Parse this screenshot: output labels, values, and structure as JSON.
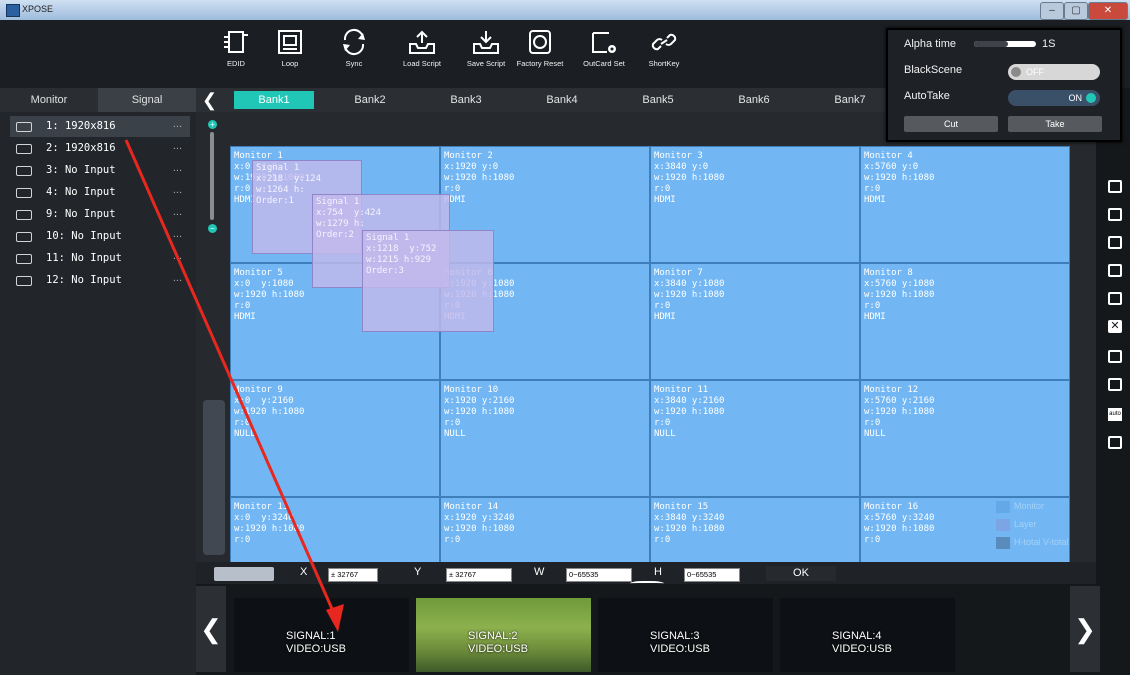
{
  "window": {
    "title": "XPOSE",
    "controls": [
      "–",
      "▢",
      "✕"
    ]
  },
  "toolbar": {
    "tools": [
      {
        "label": "EDID",
        "icon": "edid-icon"
      },
      {
        "label": "Loop",
        "icon": "loop-icon"
      },
      {
        "label": "Sync",
        "icon": "sync-icon"
      },
      {
        "label": "Load Script",
        "icon": "load-script-icon"
      },
      {
        "label": "Save Script",
        "icon": "save-script-icon"
      },
      {
        "label": "Factory Reset",
        "icon": "factory-reset-icon"
      },
      {
        "label": "OutCard Set",
        "icon": "outcard-set-icon"
      },
      {
        "label": "ShortKey",
        "icon": "shortkey-icon"
      }
    ]
  },
  "control_panel": {
    "alpha_time_label": "Alpha time",
    "alpha_time_value": "1S",
    "alpha_time_level": 0.55,
    "blackscene_label": "BlackScene",
    "blackscene_state": "OFF",
    "autotake_label": "AutoTake",
    "autotake_state": "ON",
    "cut_label": "Cut",
    "take_label": "Take",
    "accent": "#21c7b6"
  },
  "left_panel": {
    "tabs": [
      "Monitor",
      "Signal"
    ],
    "active_tab": "Signal",
    "items": [
      {
        "label": "1: 1920x816",
        "selected": true
      },
      {
        "label": "2: 1920x816",
        "selected": false
      },
      {
        "label": "3: No Input",
        "selected": false
      },
      {
        "label": "4: No Input",
        "selected": false
      },
      {
        "label": "9: No Input",
        "selected": false
      },
      {
        "label": "10: No Input",
        "selected": false
      },
      {
        "label": "11: No Input",
        "selected": false
      },
      {
        "label": "12: No Input",
        "selected": false
      }
    ],
    "more": "..."
  },
  "banks": {
    "items": [
      "Bank1",
      "Bank2",
      "Bank3",
      "Bank4",
      "Bank5",
      "Bank6",
      "Bank7"
    ],
    "active": "Bank1",
    "prev": "❮"
  },
  "monitors": [
    {
      "text": "Monitor 1\nx:0  y:0\nw:1920 h:1080\nr:0\nHDMI"
    },
    {
      "text": "Monitor 2\nx:1920 y:0\nw:1920 h:1080\nr:0\nHDMI"
    },
    {
      "text": "Monitor 3\nx:3840 y:0\nw:1920 h:1080\nr:0\nHDMI"
    },
    {
      "text": "Monitor 4\nx:5760 y:0\nw:1920 h:1080\nr:0\nHDMI"
    },
    {
      "text": "Monitor 5\nx:0  y:1080\nw:1920 h:1080\nr:0\nHDMI"
    },
    {
      "text": "Monitor 6\nx:1920 y:1080\nw:1920 h:1080\nr:0\nHDMI"
    },
    {
      "text": "Monitor 7\nx:3840 y:1080\nw:1920 h:1080\nr:0\nHDMI"
    },
    {
      "text": "Monitor 8\nx:5760 y:1080\nw:1920 h:1080\nr:0\nHDMI"
    },
    {
      "text": "Monitor 9\nx:0  y:2160\nw:1920 h:1080\nr:0\nNULL"
    },
    {
      "text": "Monitor 10\nx:1920 y:2160\nw:1920 h:1080\nr:0\nNULL"
    },
    {
      "text": "Monitor 11\nx:3840 y:2160\nw:1920 h:1080\nr:0\nNULL"
    },
    {
      "text": "Monitor 12\nx:5760 y:2160\nw:1920 h:1080\nr:0\nNULL"
    },
    {
      "text": "Monitor 13\nx:0  y:3240\nw:1920 h:1080\nr:0"
    },
    {
      "text": "Monitor 14\nx:1920 y:3240\nw:1920 h:1080\nr:0"
    },
    {
      "text": "Monitor 15\nx:3840 y:3240\nw:1920 h:1080\nr:0"
    },
    {
      "text": "Monitor 16\nx:5760 y:3240\nw:1920 h:1080\nr:0"
    }
  ],
  "signals": [
    {
      "text": "Signal 1\nx:218  y:124\nw:1264 h:\nOrder:1"
    },
    {
      "text": "Signal 1\nx:754  y:424\nw:1279 h:\nOrder:2"
    },
    {
      "text": "Signal 1\nx:1218  y:752\nw:1215 h:929\nOrder:3"
    }
  ],
  "legend": {
    "items": [
      "Monitor",
      "Layer",
      "H-total V-total"
    ]
  },
  "coords": {
    "x_label": "X",
    "x_value": "± 32767",
    "y_label": "Y",
    "y_value": "± 32767",
    "w_label": "W",
    "w_value": "0~65535",
    "h_label": "H",
    "h_value": "0~65535",
    "ok_label": "OK"
  },
  "sources": {
    "prev": "❮",
    "next": "❯",
    "items": [
      {
        "line1": "SIGNAL:1",
        "line2": "VIDEO:USB"
      },
      {
        "line1": "SIGNAL:2",
        "line2": "VIDEO:USB"
      },
      {
        "line1": "SIGNAL:3",
        "line2": "VIDEO:USB"
      },
      {
        "line1": "SIGNAL:4",
        "line2": "VIDEO:USB"
      }
    ]
  },
  "right_icons": [
    "window-icon",
    "window-icon",
    "window-icon",
    "picture-icon",
    "picture-edit-icon",
    "close-box-icon",
    "copy-icon",
    "document-icon",
    "auto-icon",
    "on-icon"
  ],
  "colors": {
    "monitor": "#72b7f4",
    "signal": "#c3b9eb",
    "annotation_arrow": "#e8281f"
  }
}
